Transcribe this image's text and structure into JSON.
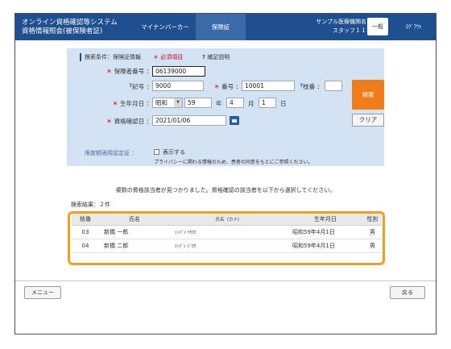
{
  "header": {
    "app_title_line1": "オンライン資格確認等システム",
    "app_title_line2": "資格情報照会(被保険者証)",
    "tabs": [
      "マイナンバーカード",
      "保険証"
    ],
    "facility_name": "サンプル医療機関名",
    "staff_name": "スタッフ１１",
    "mode_label": "一般",
    "logout_label": "ﾛｸﾞｱｳﾄ",
    "bar_color": "#1e4f8f"
  },
  "search": {
    "condition_label": "検索条件：保険証情報",
    "required_legend": "＊ 必須項目",
    "help_legend_mark": "?",
    "help_legend": "補足説明",
    "fields": {
      "insurer_no": {
        "label": "保険者番号",
        "value": "06139000"
      },
      "kigo": {
        "label": "記号",
        "value": "9000"
      },
      "bango": {
        "label": "番号",
        "value": "10001"
      },
      "edaban": {
        "label": "枝番",
        "value": ""
      },
      "birth": {
        "label": "生年月日",
        "era": "昭和",
        "year": "59",
        "year_unit": "年",
        "month": "4",
        "month_unit": "月",
        "day": "1",
        "day_unit": "日"
      },
      "confirm_date": {
        "label": "資格確認日",
        "value": "2021/01/06"
      }
    },
    "search_button": "検索",
    "clear_button": "クリア",
    "gendo_label": "限度額適用認定証",
    "gendo_checkbox_label": "表示する",
    "privacy_note": "プライバシーに関わる情報のため、患者の同意をもとにご参照ください。",
    "accent_color": "#f07d17"
  },
  "message": "複数の資格該当者が見つかりました。資格確認の該当者を以下から選択してください。",
  "results": {
    "count_label": "検索結果：２件",
    "columns": [
      "枝番",
      "氏名",
      "氏名（カナ）",
      "生年月日",
      "性別"
    ],
    "rows": [
      {
        "edaban": "03",
        "name": "新橋 一郎",
        "kana": "ｼﾝﾊﾞｼ ｲﾁﾛｳ",
        "birth": "昭和59年4月1日",
        "sex": "男"
      },
      {
        "edaban": "04",
        "name": "新橋 二郎",
        "kana": "ｼﾝﾊﾞｼ ｼﾞﾛｳ",
        "birth": "昭和59年4月1日",
        "sex": "男"
      }
    ],
    "highlight_color": "#f0a020"
  },
  "footer": {
    "menu_button": "メニュー",
    "back_button": "戻る"
  }
}
